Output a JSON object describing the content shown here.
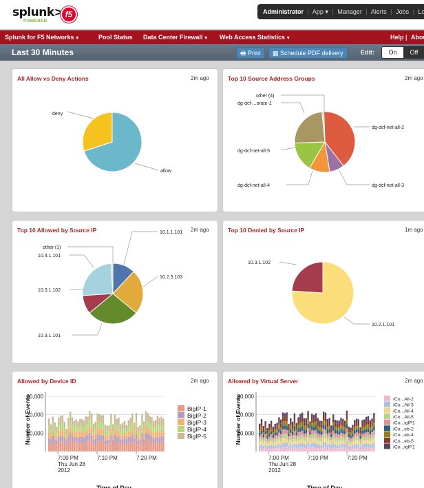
{
  "header": {
    "brand": "splunk>",
    "brand_sub": "POWERED",
    "partner_logo": "f5",
    "account": {
      "user": "Administrator",
      "app": "App",
      "manager": "Manager",
      "alerts": "Alerts",
      "jobs": "Jobs",
      "logout": "Logout"
    }
  },
  "nav": {
    "items": [
      {
        "label": "Splunk for F5 Networks",
        "dropdown": true
      },
      {
        "label": "Pool Status",
        "dropdown": false
      },
      {
        "label": "Data Center Firewall",
        "dropdown": true
      },
      {
        "label": "Web Access Statistics",
        "dropdown": true
      }
    ],
    "help": "Help",
    "about": "About"
  },
  "dashboard": {
    "title": "Last 30 Minutes",
    "print": "Print",
    "schedule_pdf": "Schedule PDF delivery",
    "edit_label": "Edit:",
    "toggle_on": "On",
    "toggle_off": "Off"
  },
  "colors": {
    "nav_red": "#a4121f",
    "panel_title_red": "#b1201f",
    "button_blue": "#4e86b5"
  },
  "panels": [
    {
      "title": "All Allow vs Deny Actions",
      "time": "2m ago"
    },
    {
      "title": "Top 10 Source Address Groups",
      "time": "2m ago"
    },
    {
      "title": "Top 10 Allowed by Source IP",
      "time": "2m ago"
    },
    {
      "title": "Top 10 Denied by Source IP",
      "time": "1m ago"
    },
    {
      "title": "Allowed by Device ID",
      "time": "2m ago"
    },
    {
      "title": "Allowed by Virtual Server",
      "time": "2m ago"
    }
  ],
  "chart_data": [
    {
      "type": "pie",
      "slices": [
        {
          "label": "allow",
          "value": 70,
          "color": "#6bb8cb"
        },
        {
          "label": "deny",
          "value": 30,
          "color": "#f6c21f"
        }
      ]
    },
    {
      "type": "pie",
      "slices": [
        {
          "label": "dg-dcf-net-all-2",
          "value": 40,
          "color": "#dd5b3e"
        },
        {
          "label": "dg-dcf-net-all-3",
          "value": 8,
          "color": "#9d72a2"
        },
        {
          "label": "dg-dcf-net-all-4",
          "value": 11,
          "color": "#f3953a"
        },
        {
          "label": "dg-dcf-net-all-5",
          "value": 16,
          "color": "#99c543"
        },
        {
          "label": "dg-dcf-...orate-1",
          "value": 24,
          "color": "#a89663"
        },
        {
          "label": "other (4)",
          "value": 1,
          "color": "#cccccc"
        }
      ]
    },
    {
      "type": "pie",
      "slices": [
        {
          "label": "10.1.1.101",
          "value": 12,
          "color": "#4f75ad"
        },
        {
          "label": "10.2.5.103",
          "value": 24,
          "color": "#e2aa3b"
        },
        {
          "label": "10.3.1.101",
          "value": 28,
          "color": "#638a2b"
        },
        {
          "label": "10.3.1.102",
          "value": 10,
          "color": "#a53c4b"
        },
        {
          "label": "10.4.1.101",
          "value": 25,
          "color": "#a6d2df"
        },
        {
          "label": "other (1)",
          "value": 1,
          "color": "#cccccc"
        }
      ]
    },
    {
      "type": "pie",
      "slices": [
        {
          "label": "10.2.1.101",
          "value": 76,
          "color": "#fbdd7a"
        },
        {
          "label": "10.3.1.102",
          "value": 24,
          "color": "#a53c4b"
        }
      ]
    },
    {
      "type": "bar",
      "stacked": true,
      "ylabel": "Number of Events",
      "xlabel": "Time of Day",
      "yticks": [
        "10,000",
        "20,000",
        "30,000"
      ],
      "ylim": [
        0,
        30000
      ],
      "xticks": [
        "7:00 PM\nThu Jun 28\n2012",
        "7:10 PM",
        "7:20 PM"
      ],
      "series": [
        {
          "name": "BigIP-1",
          "color": "#e49a86",
          "value": 5000
        },
        {
          "name": "BigIP-2",
          "color": "#b49dc1",
          "value": 3000
        },
        {
          "name": "BigIP-3",
          "color": "#f4b174",
          "value": 3000
        },
        {
          "name": "BigIP-4",
          "color": "#b8d77f",
          "value": 3000
        },
        {
          "name": "BigIP-5",
          "color": "#c8bb96",
          "value": 4000
        }
      ]
    },
    {
      "type": "bar",
      "stacked": true,
      "ylabel": "Number of Events",
      "xlabel": "Time of Day",
      "yticks": [
        "10,000",
        "20,000",
        "30,000"
      ],
      "ylim": [
        0,
        30000
      ],
      "xticks": [
        "7:00 PM\nThu Jun 28\n2012",
        "7:10 PM",
        "7:20 PM"
      ],
      "series": [
        {
          "name": "/Co...All-2",
          "color": "#f0b6d0",
          "value": 2000
        },
        {
          "name": "/Co...All-3",
          "color": "#a9c2e2",
          "value": 2000
        },
        {
          "name": "/Co...All-4",
          "color": "#f5d48d",
          "value": 2000
        },
        {
          "name": "/Co...All-5",
          "color": "#b6d38f",
          "value": 2000
        },
        {
          "name": "/Co...igIP1",
          "color": "#e2919a",
          "value": 2000
        },
        {
          "name": "/Co...eb-2",
          "color": "#2f5f7f",
          "value": 2000
        },
        {
          "name": "/Co...eb-4",
          "color": "#8f7f1f",
          "value": 2000
        },
        {
          "name": "/Co...eb-5",
          "color": "#8a3a2a",
          "value": 2000
        },
        {
          "name": "/Co...igIP1",
          "color": "#5a4561",
          "value": 2000
        }
      ]
    }
  ]
}
